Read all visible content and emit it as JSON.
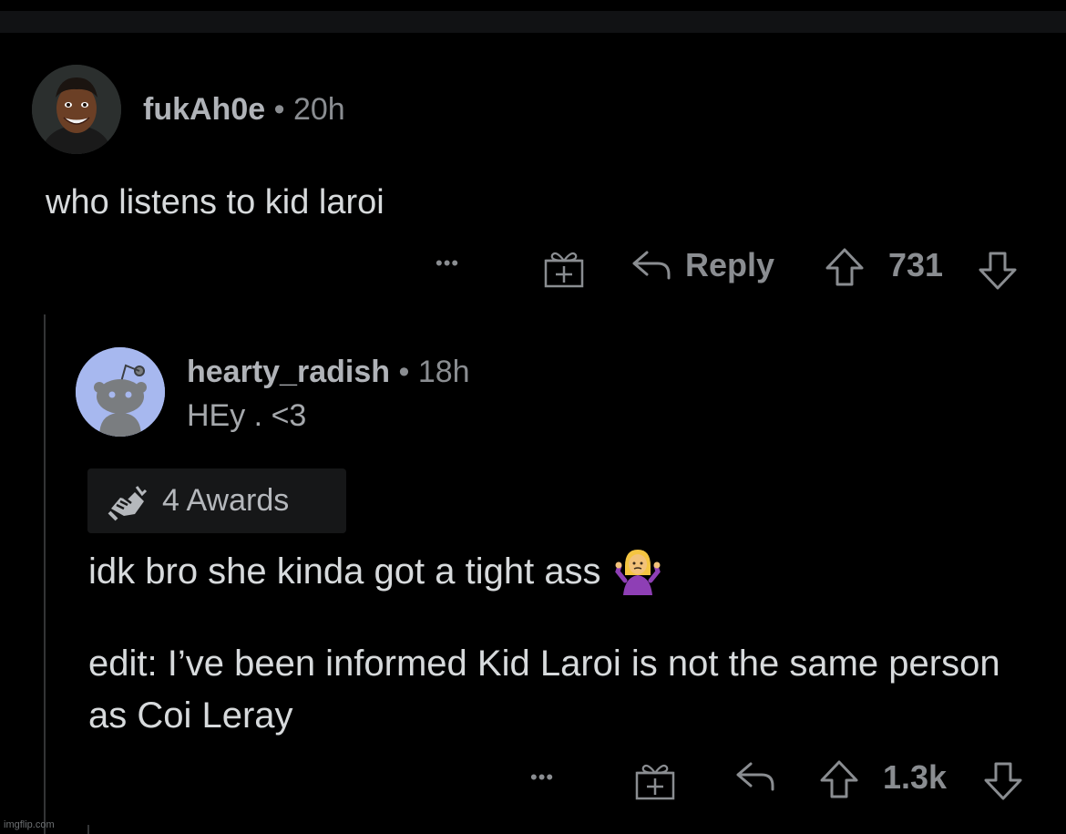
{
  "comments": [
    {
      "username": "fukAh0e",
      "separator": "•",
      "age": "20h",
      "body": "who listens to kid laroi",
      "actions": {
        "more": "•••",
        "reply_label": "Reply",
        "score": "731"
      }
    },
    {
      "username": "hearty_radish",
      "separator": "•",
      "age": "18h",
      "flair": "HEy . <3",
      "awards_label": "4 Awards",
      "body_line1": "idk bro she kinda got a tight ass",
      "body_edit": "edit: I’ve been informed Kid Laroi is not the same person as Coi Leray",
      "actions": {
        "more": "•••",
        "score": "1.3k"
      }
    }
  ],
  "watermark": "imgflip.com",
  "icons": {
    "gift": "gift-icon",
    "reply": "reply-arrow-icon",
    "upvote": "upvote-arrow-icon",
    "downvote": "downvote-arrow-icon",
    "award": "handshake-award-icon",
    "shrug": "person-shrugging-emoji"
  },
  "colors": {
    "background": "#000000",
    "text_primary": "#d7dadc",
    "text_muted": "#8a8d91",
    "thread_line": "#343536",
    "awards_bg": "#161718",
    "snoo_avatar_bg": "#a7b8ef"
  }
}
